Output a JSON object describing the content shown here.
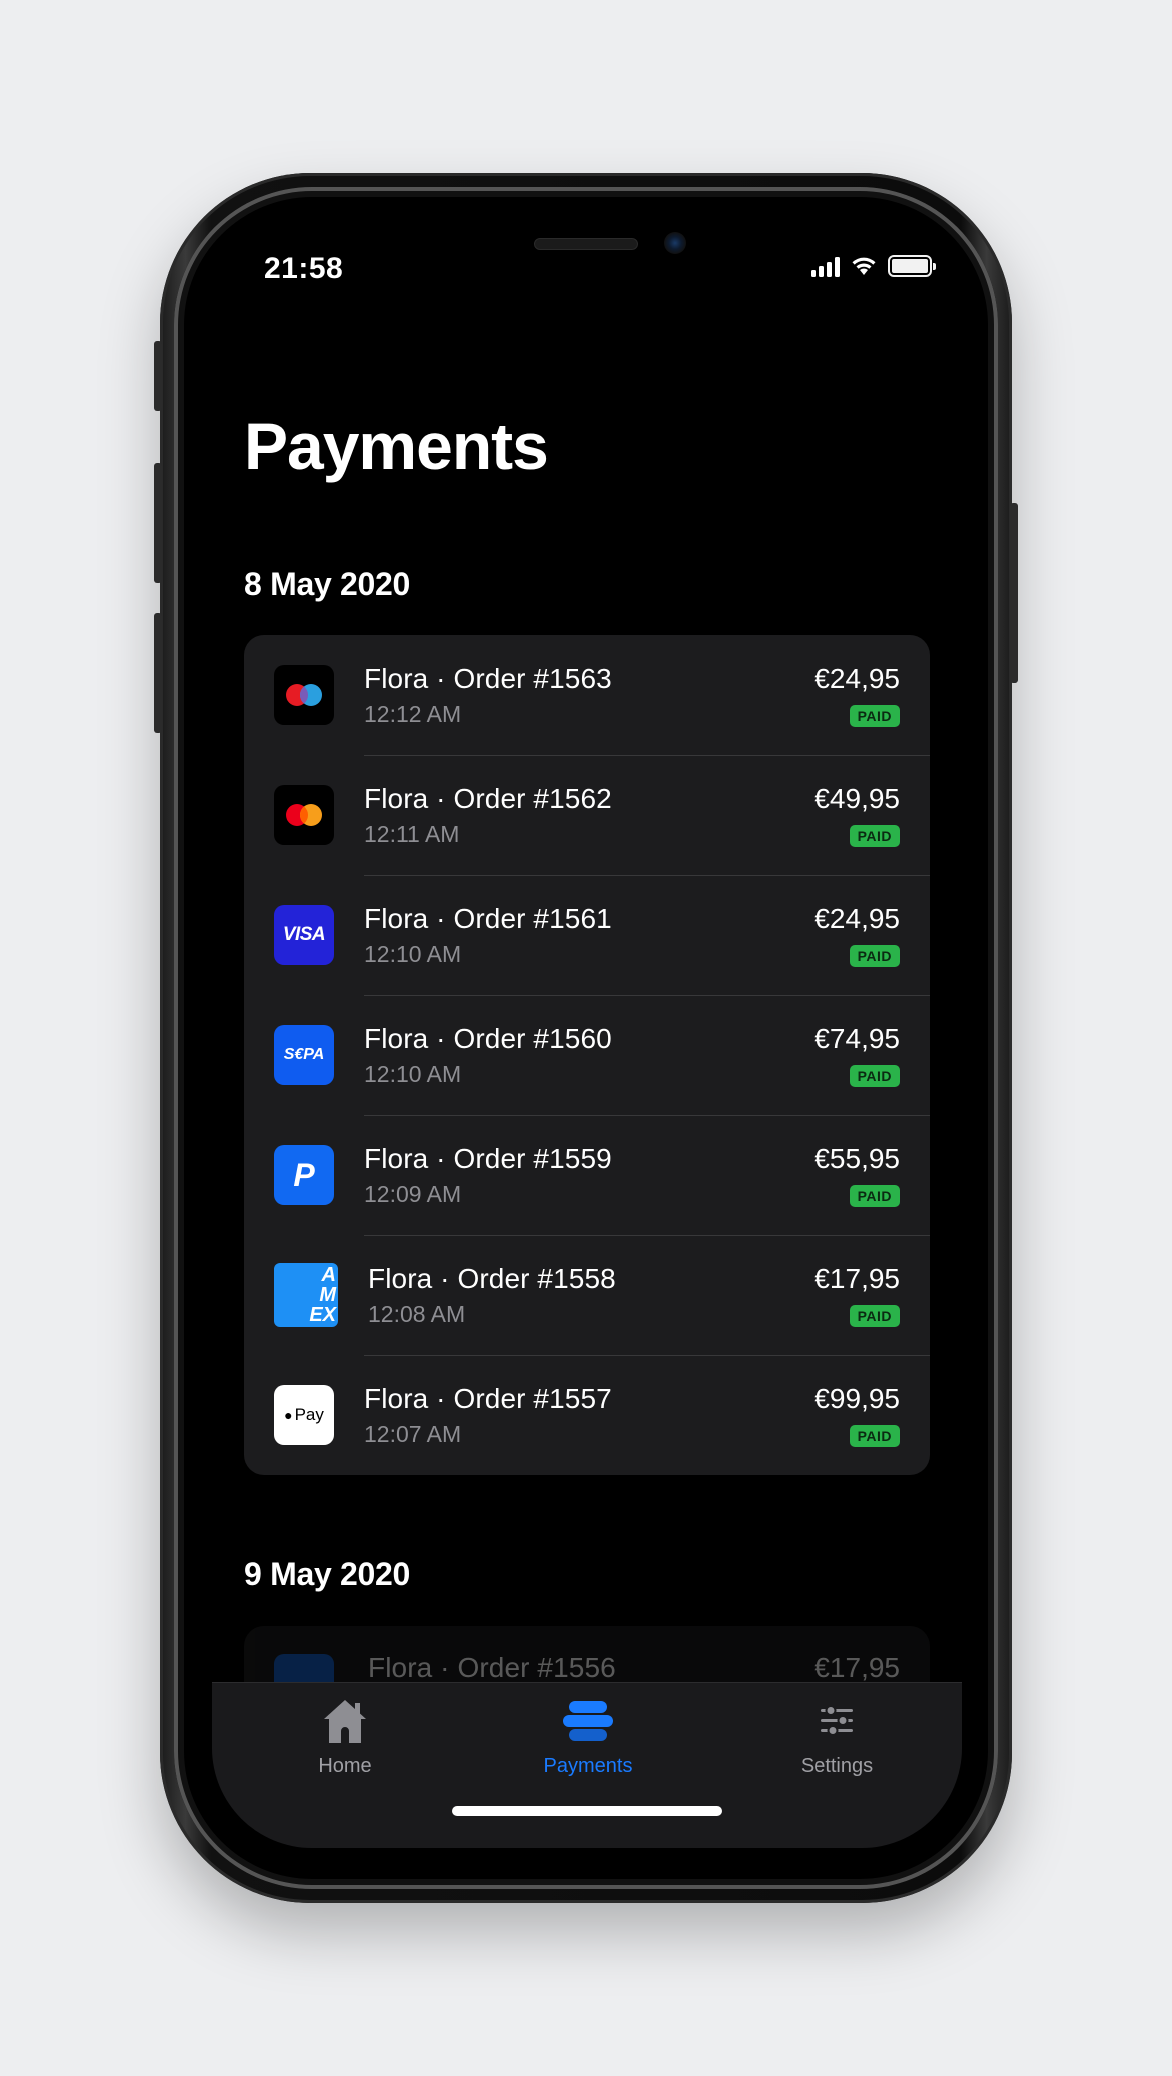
{
  "status_bar": {
    "time": "21:58"
  },
  "header": {
    "title": "Payments"
  },
  "sections": [
    {
      "date": "8 May 2020",
      "payments": [
        {
          "title": "Flora · Order #1563",
          "time": "12:12 AM",
          "amount": "€24,95",
          "status": "PAID",
          "method": "maestro-icon"
        },
        {
          "title": "Flora · Order #1562",
          "time": "12:11 AM",
          "amount": "€49,95",
          "status": "PAID",
          "method": "mastercard-icon"
        },
        {
          "title": "Flora · Order #1561",
          "time": "12:10 AM",
          "amount": "€24,95",
          "status": "PAID",
          "method": "visa-icon",
          "logo_text": "VISA"
        },
        {
          "title": "Flora · Order #1560",
          "time": "12:10 AM",
          "amount": "€74,95",
          "status": "PAID",
          "method": "sepa-icon",
          "logo_text": "S€PA"
        },
        {
          "title": "Flora · Order #1559",
          "time": "12:09 AM",
          "amount": "€55,95",
          "status": "PAID",
          "method": "paypal-icon",
          "logo_text": "P"
        },
        {
          "title": "Flora · Order #1558",
          "time": "12:08 AM",
          "amount": "€17,95",
          "status": "PAID",
          "method": "amex-icon",
          "logo_text": "AM EX"
        },
        {
          "title": "Flora · Order #1557",
          "time": "12:07 AM",
          "amount": "€99,95",
          "status": "PAID",
          "method": "apple-pay-icon",
          "logo_text": "Pay"
        }
      ]
    },
    {
      "date": "9 May 2020",
      "payments": [
        {
          "title": "Flora · Order #1556",
          "amount": "€17,95"
        }
      ]
    }
  ],
  "tabbar": {
    "tabs": [
      {
        "label": "Home",
        "icon": "house-icon",
        "active": false
      },
      {
        "label": "Payments",
        "icon": "payments-icon",
        "active": true
      },
      {
        "label": "Settings",
        "icon": "sliders-icon",
        "active": false
      }
    ]
  },
  "colors": {
    "accent": "#1a7bff",
    "paid_badge": "#2ab34a",
    "card_bg": "#1c1c1e",
    "screen_bg": "#000000"
  }
}
